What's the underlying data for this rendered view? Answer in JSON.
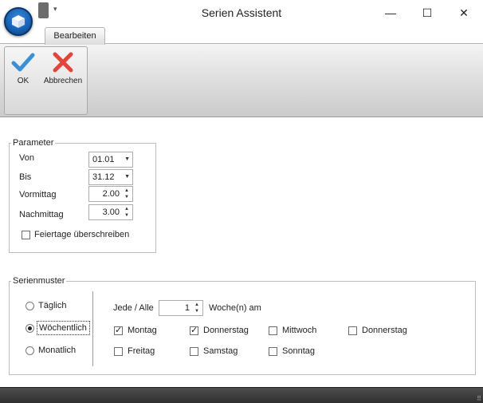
{
  "window": {
    "title": "Serien Assistent",
    "minimize": "—",
    "maximize": "☐",
    "close": "✕",
    "qat_dropdown": "▾"
  },
  "ribbon": {
    "active_tab": "Bearbeiten",
    "ok_label": "OK",
    "cancel_label": "Abbrechen",
    "ok_color": "#3c8fd6",
    "cancel_color": "#e2453b"
  },
  "parameter": {
    "legend": "Parameter",
    "von": {
      "label": "Von",
      "value": "01.01"
    },
    "bis": {
      "label": "Bis",
      "value": "31.12"
    },
    "vormittag": {
      "label": "Vormittag",
      "value": "2.00"
    },
    "nachmittag": {
      "label": "Nachmittag",
      "value": "3.00"
    },
    "feiertage": {
      "label": "Feiertage überschreiben",
      "checked": false
    }
  },
  "serienmuster": {
    "legend": "Serienmuster",
    "modes": [
      {
        "label": "Täglich",
        "selected": false
      },
      {
        "label": "Wöchentlich",
        "selected": true
      },
      {
        "label": "Monatlich",
        "selected": false
      }
    ],
    "jede_label": "Jede / Alle",
    "interval": "1",
    "woche_label": "Woche(n) am",
    "days": [
      {
        "label": "Montag",
        "checked": true
      },
      {
        "label": "Donnerstag",
        "checked": true
      },
      {
        "label": "Mittwoch",
        "checked": false
      },
      {
        "label": "Donnerstag",
        "checked": false
      },
      {
        "label": "Freitag",
        "checked": false
      },
      {
        "label": "Samstag",
        "checked": false
      },
      {
        "label": "Sonntag",
        "checked": false
      }
    ]
  },
  "glyphs": {
    "arrow_down": "▼",
    "spin_up": "▲",
    "spin_down": "▼",
    "check": "✓",
    "grip": "⠿"
  }
}
